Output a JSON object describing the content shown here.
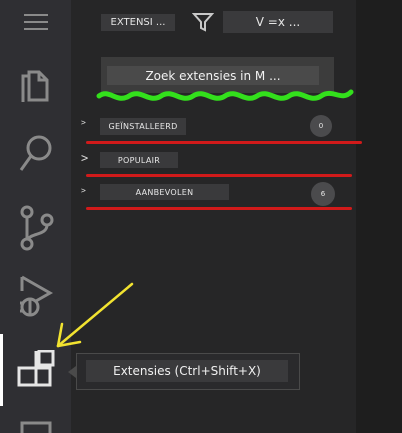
{
  "activity_bar": {
    "items": [
      {
        "name": "menu-icon"
      },
      {
        "name": "explorer-icon"
      },
      {
        "name": "search-icon"
      },
      {
        "name": "source-control-icon"
      },
      {
        "name": "run-debug-icon"
      },
      {
        "name": "extensions-icon"
      }
    ]
  },
  "toolbar": {
    "view_title": "EXTENSI ...",
    "filter_icon": "filter-icon",
    "more_actions": "V =x ..."
  },
  "search": {
    "placeholder": "Zoek extensies in M ..."
  },
  "sections": [
    {
      "label": "GEÏNSTALLEERD",
      "count": "0"
    },
    {
      "label": "POPULAIR"
    },
    {
      "label": "AANBEVOLEN",
      "count": "6"
    }
  ],
  "tooltip": {
    "text": "Extensies (Ctrl+Shift+X)"
  },
  "colors": {
    "annotation_red": "#d11a1a",
    "annotation_green": "#33e01c",
    "annotation_yellow": "#f2e330"
  }
}
